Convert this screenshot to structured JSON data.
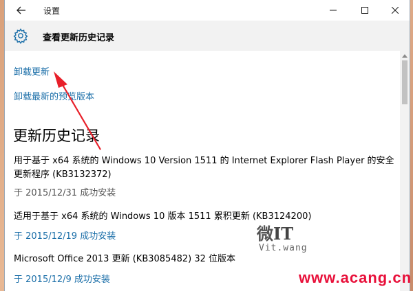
{
  "window": {
    "app_title": "设置",
    "page_title": "查看更新历史记录"
  },
  "links": {
    "uninstall_updates": "卸载更新",
    "uninstall_latest_preview": "卸载最新的预览版本"
  },
  "section_title": "更新历史记录",
  "updates": [
    {
      "name_line1": "用于基于 x64 系统的 Windows 10 Version 1511 的 Internet Explorer Flash Player 的安全",
      "name_line2": "更新程序 (KB3132372)",
      "status": "于 2015/12/31 成功安装"
    },
    {
      "name_line1": "适用于基于 x64 系统的 Windows 10 版本 1511 累积更新 (KB3124200)",
      "status": "于 2015/12/19 成功安装"
    },
    {
      "name_line1": "Microsoft Office 2013 更新 (KB3085482) 32 位版本",
      "status": "于 2015/12/9 成功安装"
    }
  ],
  "watermarks": {
    "logo_prefix": "微",
    "logo_it": "IT",
    "site": "Vit.wang",
    "url": "www.acang.cn"
  },
  "colors": {
    "link": "#1a6ea8",
    "status_link": "#1a6ea8",
    "status_gray": "#555555",
    "arrow": "#e8202a",
    "watermark_url": "#e8103a"
  },
  "icons": {
    "back": "back-arrow-icon",
    "gear": "gear-icon",
    "minimize": "minimize-icon",
    "maximize": "maximize-icon",
    "close": "close-icon",
    "scroll_up": "chevron-up-icon"
  }
}
